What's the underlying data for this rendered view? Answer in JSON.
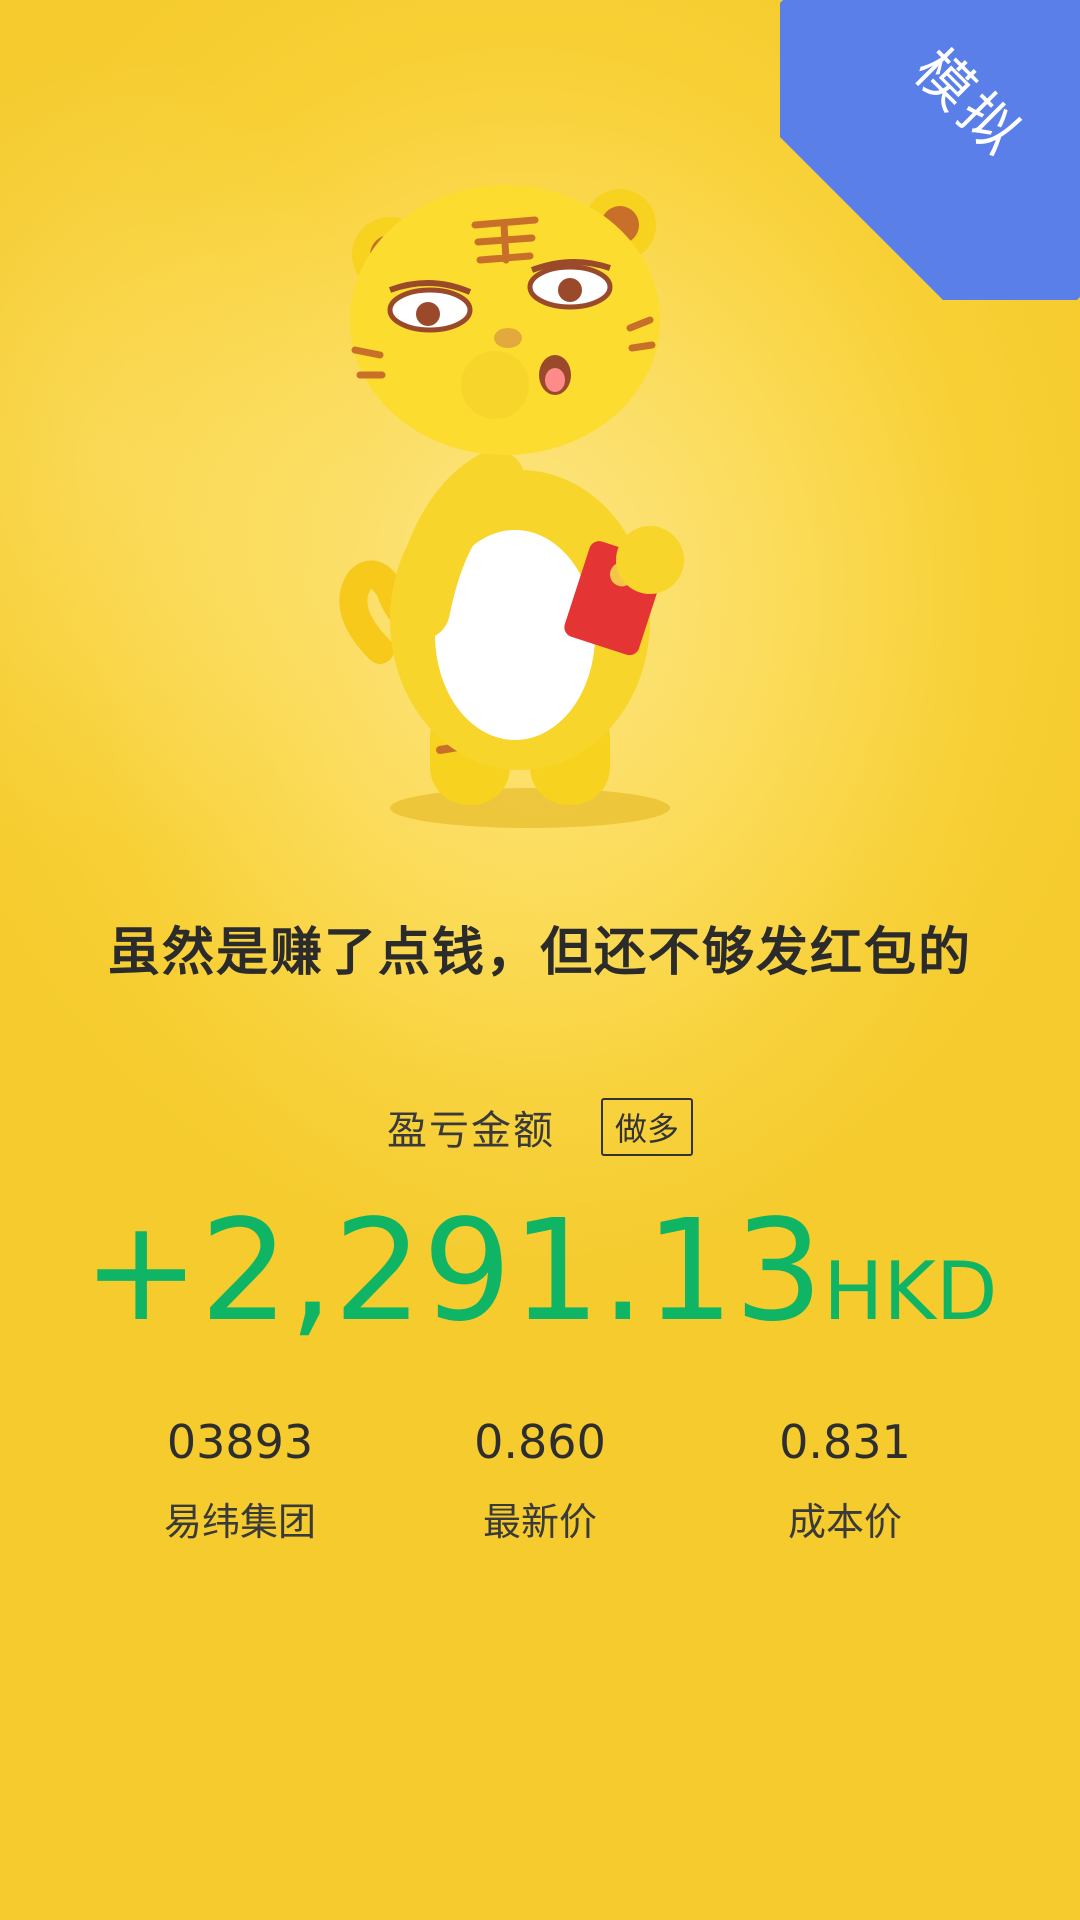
{
  "ribbon": {
    "label": "模拟"
  },
  "headline": "虽然是赚了点钱，但还不够发红包的",
  "pl": {
    "label": "盈亏金额",
    "direction_tag": "做多",
    "amount": "+2,291.13",
    "currency": "HKD"
  },
  "stats": {
    "code": "03893",
    "name": "易纬集团",
    "latest_price": "0.860",
    "latest_price_label": "最新价",
    "cost_price": "0.831",
    "cost_price_label": "成本价"
  },
  "colors": {
    "background": "#f8d035",
    "ribbon": "#5a7fe8",
    "profit": "#0fb564",
    "text": "#2b2b2b"
  },
  "icons": {
    "mascot": "tiger-mascot-with-red-envelope"
  }
}
